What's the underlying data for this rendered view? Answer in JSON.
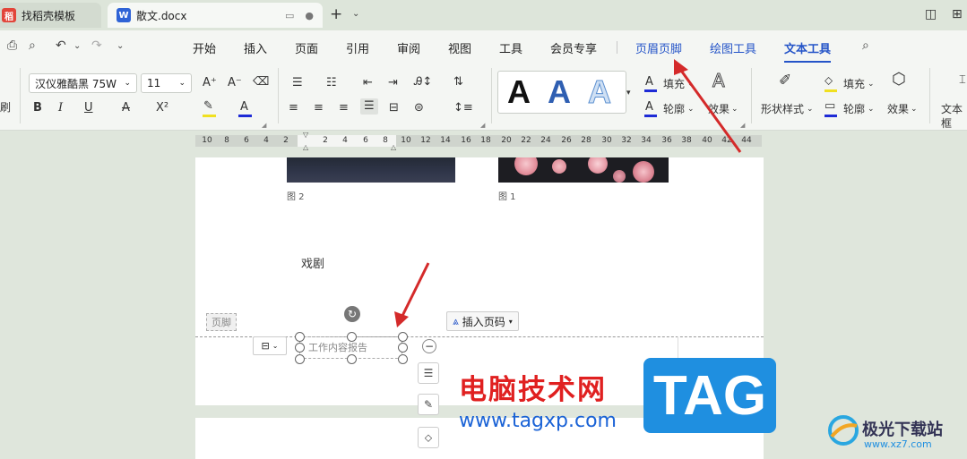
{
  "tabs": [
    {
      "label": "找稻壳模板",
      "icon": "docer-icon"
    },
    {
      "label": "散文.docx",
      "icon": "word-icon"
    }
  ],
  "menu": [
    "开始",
    "插入",
    "页面",
    "引用",
    "审阅",
    "视图",
    "工具",
    "会员专享",
    "页眉页脚",
    "绘图工具",
    "文本工具"
  ],
  "ribbon": {
    "font_name": "汉仪雅酷黑 75W",
    "font_size": "11",
    "fill_label": "填充",
    "outline_label": "轮廓",
    "effect_label": "效果",
    "shape_style_label": "形状样式",
    "shape_fill_label": "填充",
    "shape_outline_label": "轮廓",
    "shape_effect_label": "效果",
    "textbox_label": "文本框"
  },
  "ruler_numbers": [
    "10",
    "8",
    "6",
    "4",
    "2",
    "2",
    "4",
    "6",
    "8",
    "10",
    "12",
    "14",
    "16",
    "18",
    "20",
    "22",
    "24",
    "26",
    "28",
    "30",
    "32",
    "34",
    "36",
    "38",
    "40",
    "42",
    "44"
  ],
  "document": {
    "caption_left": "图 2",
    "caption_right": "图 1",
    "heading": "戏剧",
    "footer_tag": "页脚",
    "insert_page_number": "插入页码",
    "textbox_text": "工作内容报告"
  },
  "watermark": {
    "cn_title": "电脑技术网",
    "url": "www.tagxp.com",
    "tag": "TAG",
    "site_name": "极光下载站",
    "site_url": "www.xz7.com"
  }
}
